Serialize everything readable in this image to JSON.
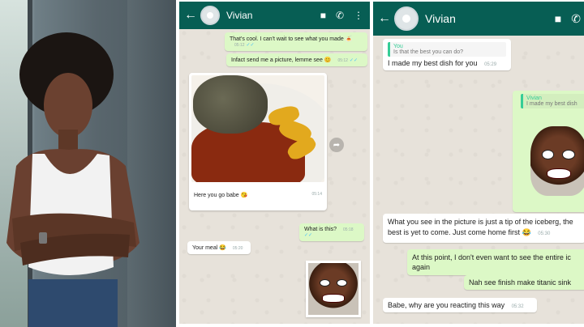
{
  "chat1": {
    "contact": "Vivian",
    "icons": {
      "back": "back-arrow-icon",
      "video": "video-call-icon",
      "call": "phone-icon",
      "menu": "more-vert-icon"
    },
    "messages": [
      {
        "text": "That's cool. I can't wait to see what you made 🍝",
        "time": "05:12"
      },
      {
        "text": "Infact send me a picture, lemme see 😊",
        "time": "05:12"
      },
      {
        "text": "Here you go babe 😘",
        "time": "05:14"
      },
      {
        "text": "What is this?",
        "time": "05:18"
      },
      {
        "text": "Your meal 😂",
        "time": "05:20"
      }
    ]
  },
  "chat2": {
    "contact": "Vivian",
    "quote1": {
      "name": "You",
      "text": "Is that the best you can do?"
    },
    "msg1": {
      "text": "I made my best dish for you",
      "time": "05:29"
    },
    "quote2": {
      "name": "Vivian",
      "text": "I made my best dish"
    },
    "msg2": {
      "text": "What you see in the picture is just a tip of the iceberg, the best is yet to come. Just come home first 😂",
      "time": "05:30"
    },
    "msg3": {
      "text": "At this point, I don't even want to see the entire ic again",
      "time": ""
    },
    "msg4": {
      "text": "Nah see finish make titanic sink",
      "time": ""
    },
    "msg5": {
      "text": "Babe, why are you reacting this way",
      "time": "05:32"
    }
  }
}
